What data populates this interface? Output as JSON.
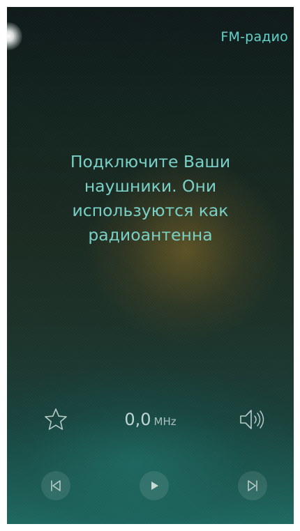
{
  "header": {
    "title": "FM-радио"
  },
  "message": {
    "line1": "Подключите Ваши",
    "line2": "наушники. Они",
    "line3": "используются как",
    "line4": "радиоантенна"
  },
  "tuner": {
    "frequency": "0,0",
    "unit": "MHz"
  },
  "icons": {
    "favorite": "star-outline-icon",
    "volume": "speaker-icon",
    "previous": "skip-previous-icon",
    "play": "play-icon",
    "next": "skip-next-icon"
  },
  "colors": {
    "accent": "#63d2c9",
    "message_text": "#79d0c7",
    "frequency_text": "#c0d6d2"
  }
}
